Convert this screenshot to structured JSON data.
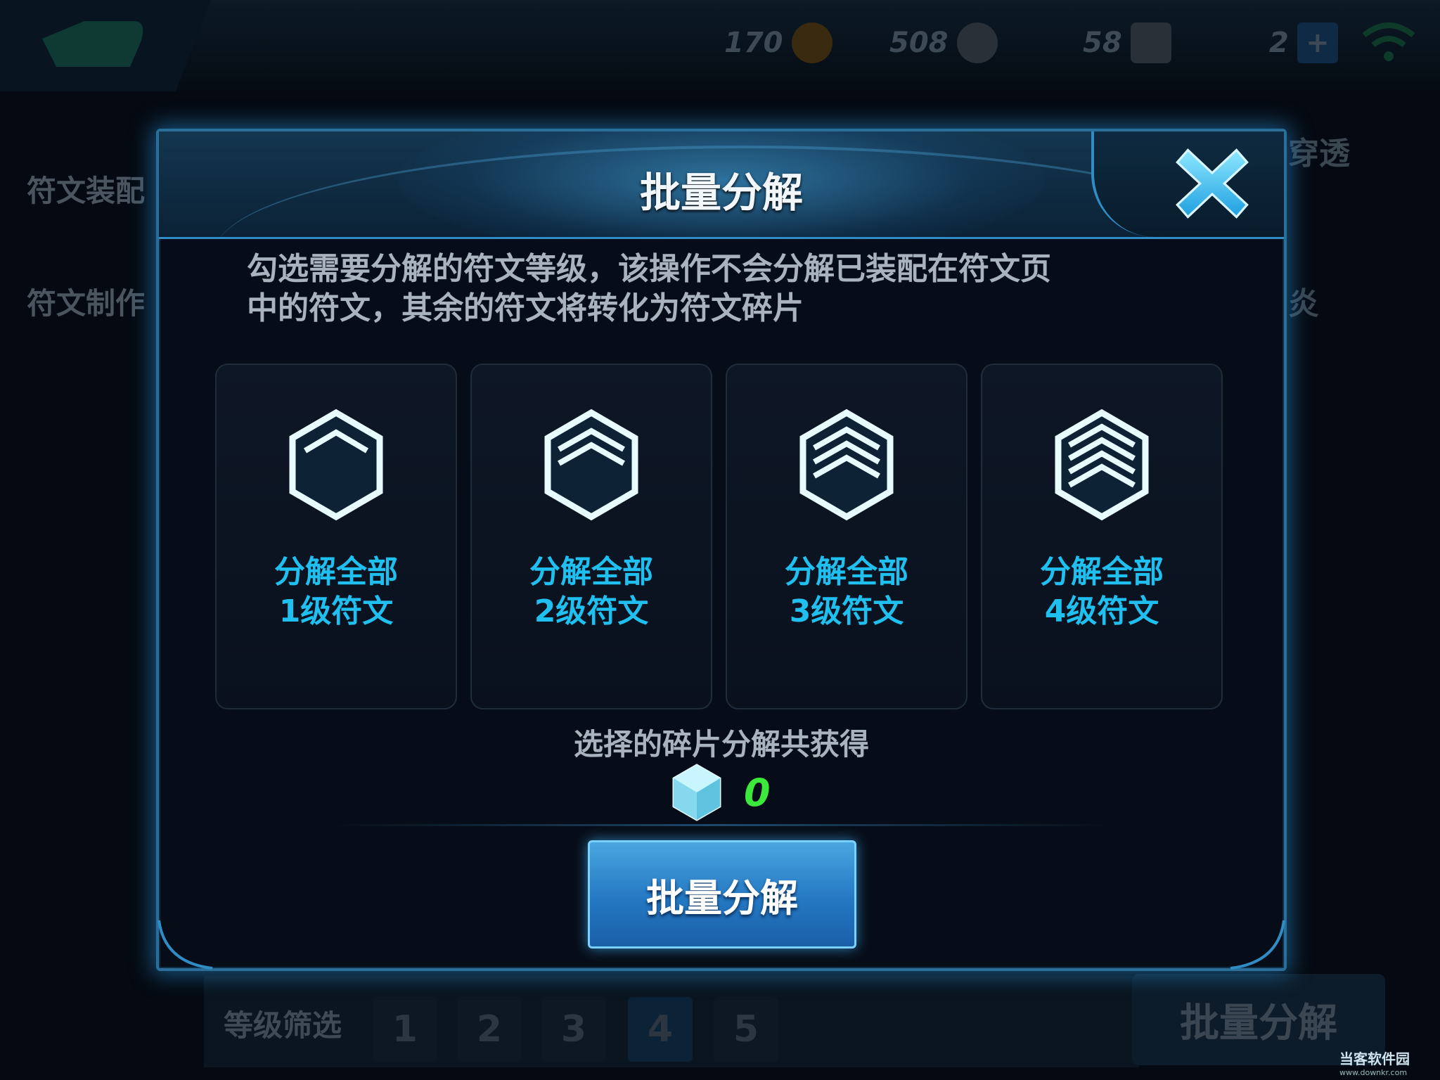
{
  "background": {
    "resources": [
      {
        "value": "170",
        "icon": "gold-coin-icon"
      },
      {
        "value": "508",
        "icon": "diamond-icon"
      },
      {
        "value": "58",
        "icon": "ticket-icon"
      },
      {
        "value": "2",
        "icon": "plus-icon"
      }
    ],
    "left_tabs": [
      "符文装配",
      "符文制作"
    ],
    "right_fragments": [
      "穿透",
      "炎"
    ],
    "filter": {
      "label": "等级筛选",
      "levels": [
        "1",
        "2",
        "3",
        "4",
        "5"
      ]
    },
    "batch_button_label": "批量分解",
    "watermark": {
      "name": "当客软件园",
      "url": "www.downkr.com"
    }
  },
  "modal": {
    "title": "批量分解",
    "description": [
      "勾选需要分解的符文等级，该操作不会分解已装配在符文页",
      "中的符文，其余的符文将转化为符文碎片"
    ],
    "cards": [
      {
        "line1": "分解全部",
        "line2": "1级符文"
      },
      {
        "line1": "分解全部",
        "line2": "2级符文"
      },
      {
        "line1": "分解全部",
        "line2": "3级符文"
      },
      {
        "line1": "分解全部",
        "line2": "4级符文"
      }
    ],
    "total_label": "选择的碎片分解共获得",
    "total_value": "0",
    "confirm_label": "批量分解"
  },
  "colors": {
    "accent": "#1fc0f0",
    "gain": "#3be83b",
    "button": "#2478c2"
  }
}
